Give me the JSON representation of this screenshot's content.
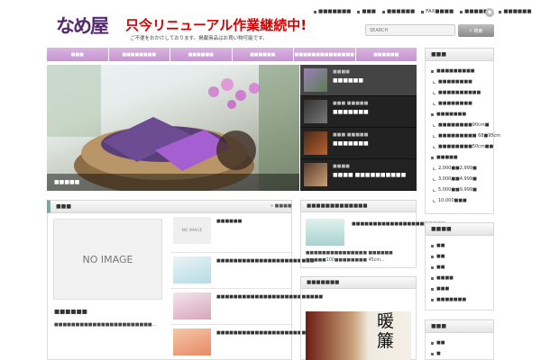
{
  "header": {
    "logo_text": "なめ屋",
    "headline": "只今リニューアル作業継続中!",
    "subline": "ご不便をおかけしております。掲載商品はお買い物可能です。"
  },
  "topnav": [
    "■■■■■■■",
    "■■■",
    "■■■■■■",
    "FAX■■■■",
    "■■■■■■",
    "■■■■■■"
  ],
  "rss_icon": "rss-icon",
  "search": {
    "placeholder": "SEARCH",
    "button_label": "検索"
  },
  "mainnav": [
    "■■■",
    "■■■■■■■■",
    "■■■■■■",
    "■■■■■■",
    "■■■■■■■■■■■■■■",
    "■■■■■■"
  ],
  "slider": {
    "caption_title": "■■■■■",
    "thumbs": [
      {
        "cat": "■■■■",
        "title": "■■■■■■"
      },
      {
        "cat": "■■■ ■■■■■",
        "title": "■■■■■■■"
      },
      {
        "cat": "■■■ ■■■■■",
        "title": "■■■■■■■"
      },
      {
        "cat": "■■■■",
        "title": "■■■■ ■■■■■■■■■■"
      }
    ]
  },
  "new_posts": {
    "heading": "■■■",
    "more": "■■■■",
    "noimage": "NO IMAGE",
    "feature_title": "■■■■■■",
    "feature_excerpt": "■■■■■■■■■■■■■■■■■■■■■■■...",
    "rows": [
      {
        "thumb": "NO IMAGE",
        "title": "■■■■■■"
      },
      {
        "thumb": "",
        "title": "■■■■■■■■■■■■■■■■■■■■■■■"
      },
      {
        "thumb": "",
        "title": "■■■■■■■■■■■■■■■■■■■■■■■■■"
      },
      {
        "thumb": "",
        "title": "■■■■■■■■■■■■■■■■■■■■■"
      }
    ]
  },
  "pickup": {
    "heading": "■■■■■■■■■■■■■",
    "title": "■■■■■■■■■■■■■■■■■■■■■■",
    "excerpt": "■■■■■■■■■■■■■■■ ■■■■■■ ■■■■■100■■■■■■■■ 45cm..."
  },
  "noren": {
    "heading": "■■■■■■■",
    "kanji": "暖簾"
  },
  "sidebar": [
    {
      "heading": "■■■",
      "items": [
        {
          "label": "■■■■■■■■■",
          "sub": false
        },
        {
          "label": "■■■■■■■■",
          "sub": true
        },
        {
          "label": "■■■■■■■■■■",
          "sub": true
        },
        {
          "label": "■■■■■■■■",
          "sub": true
        },
        {
          "label": "■■■■■■■",
          "sub": false
        },
        {
          "label": "■■■■■■■■90cm■",
          "sub": true
        },
        {
          "label": "■■■■■■■■■ 68■95cm",
          "sub": true
        },
        {
          "label": "■■■■■■■■50cm■■",
          "sub": true
        },
        {
          "label": "■■■■■",
          "sub": false
        },
        {
          "label": "2,000■■2,999■",
          "sub": true
        },
        {
          "label": "3,000■■4,999■",
          "sub": true
        },
        {
          "label": "5,000■■9,999■",
          "sub": true
        },
        {
          "label": "10,000■■■",
          "sub": true
        }
      ]
    },
    {
      "heading": "■■■■",
      "items": [
        {
          "label": "■■",
          "sub": false
        },
        {
          "label": "■■",
          "sub": false
        },
        {
          "label": "■■",
          "sub": false
        },
        {
          "label": "■■■■",
          "sub": false
        },
        {
          "label": "■■■",
          "sub": false
        },
        {
          "label": "■■■■■■■",
          "sub": false
        }
      ]
    },
    {
      "heading": "■■■",
      "items": [
        {
          "label": "■■",
          "sub": false
        },
        {
          "label": "■",
          "sub": false
        }
      ]
    }
  ]
}
